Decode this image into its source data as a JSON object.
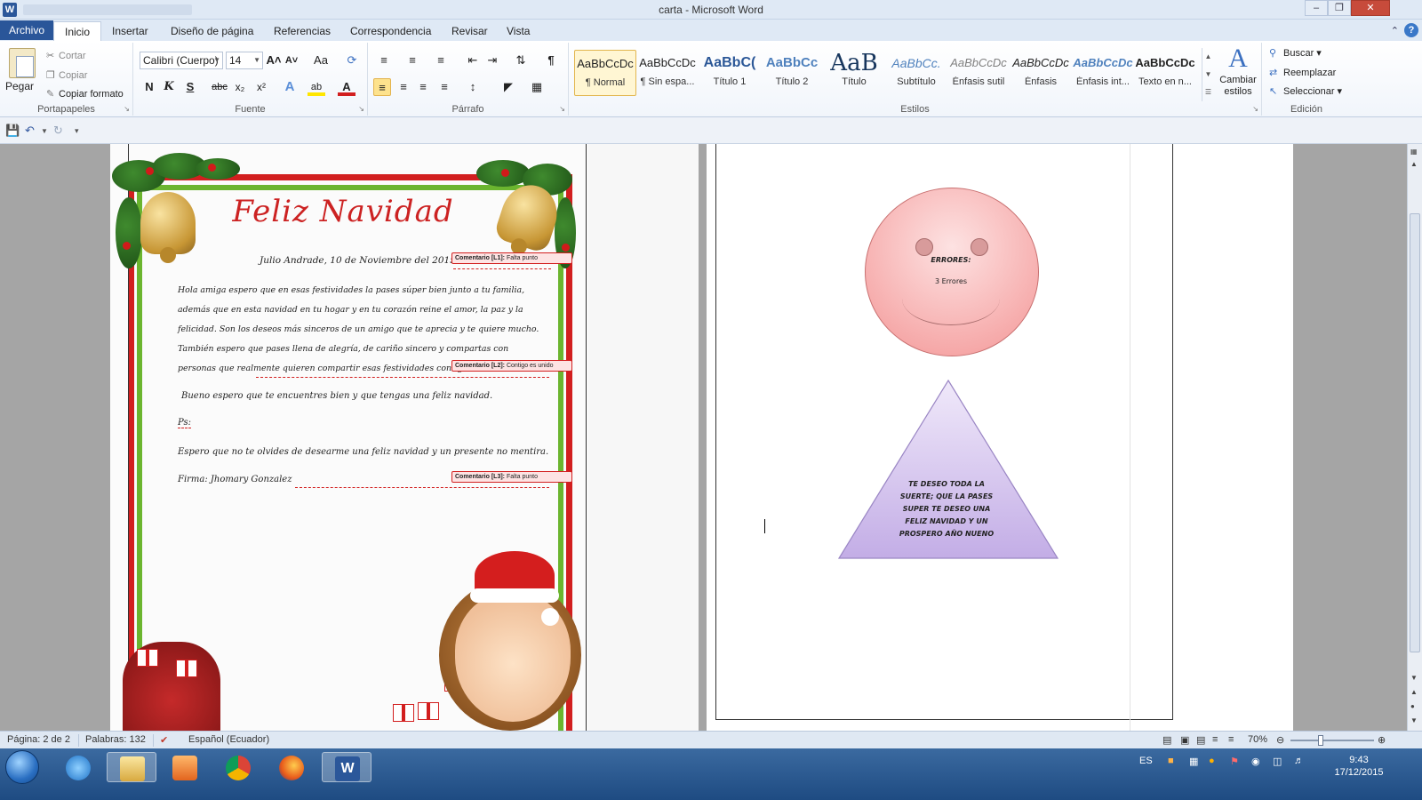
{
  "window": {
    "title": "carta - Microsoft Word",
    "app_icon": "W"
  },
  "tabs": [
    "Archivo",
    "Inicio",
    "Insertar",
    "Diseño de página",
    "Referencias",
    "Correspondencia",
    "Revisar",
    "Vista"
  ],
  "active_tab": "Inicio",
  "ribbon": {
    "clipboard": {
      "paste": "Pegar",
      "cut": "Cortar",
      "copy": "Copiar",
      "format_painter": "Copiar formato",
      "label": "Portapapeles"
    },
    "font": {
      "name": "Calibri (Cuerpo)",
      "size": "14",
      "label": "Fuente",
      "bold": "N",
      "italic": "K",
      "underline": "S",
      "strike": "abc",
      "sub": "x₂",
      "sup": "x²",
      "grow": "A˄",
      "shrink": "A˅",
      "case": "Aa"
    },
    "paragraph": {
      "label": "Párrafo",
      "pilcrow": "¶"
    },
    "styles": {
      "label": "Estilos",
      "items": [
        {
          "sample": "AaBbCcDc",
          "name": "¶ Normal"
        },
        {
          "sample": "AaBbCcDc",
          "name": "¶ Sin espa..."
        },
        {
          "sample": "AaBbC(",
          "name": "Título 1"
        },
        {
          "sample": "AaBbCc",
          "name": "Título 2"
        },
        {
          "sample": "AaB",
          "name": "Título"
        },
        {
          "sample": "AaBbCc.",
          "name": "Subtítulo"
        },
        {
          "sample": "AaBbCcDc",
          "name": "Énfasis sutil"
        },
        {
          "sample": "AaBbCcDc",
          "name": "Énfasis"
        },
        {
          "sample": "AaBbCcDc",
          "name": "Énfasis int..."
        },
        {
          "sample": "AaBbCcDc",
          "name": "Texto en n..."
        }
      ],
      "change_styles": "Cambiar estilos"
    },
    "editing": {
      "label": "Edición",
      "find": "Buscar",
      "replace": "Reemplazar",
      "select": "Seleccionar"
    }
  },
  "letter": {
    "title": "Feliz Navidad",
    "date_line": "Julio Andrade, 10 de Noviembre del 2015",
    "paragraph": "Hola amiga espero que en esas festividades la pases súper bien junto a tu familia, además que en esta navidad en tu hogar y en tu corazón reine el amor, la paz y la felicidad. Son los deseos más sinceros de un amigo que te aprecia y te quiere mucho. También espero que pases llena de alegría, de cariño sincero y compartas con personas que realmente quieren compartir esas festividades contigo.",
    "line2": "Bueno espero que te encuentres bien y que tengas una feliz navidad.",
    "ps": "Ps:",
    "line3": "Espero que no te olvides de desearme una feliz navidad y un presente no mentira.",
    "signature": "Firma: Jhomary Gonzalez"
  },
  "comments": [
    {
      "tag": "Comentario [L1]:",
      "text": "Falta punto"
    },
    {
      "tag": "Comentario [L2]:",
      "text": "Contigo es unido"
    },
    {
      "tag": "Comentario [L3]:",
      "text": "Falta punto"
    }
  ],
  "page2": {
    "errors_title": "ERRORES:",
    "errors_count": "3 Errores",
    "triangle_text": "TE DESEO TODA LA SUERTE; QUE LA PASES SUPER TE DESEO UNA FELIZ NAVIDAD Y UN PROSPERO AÑO NUENO"
  },
  "status": {
    "page": "Página: 2 de 2",
    "words": "Palabras: 132",
    "language": "Español (Ecuador)",
    "zoom": "70%"
  },
  "taskbar": {
    "time": "9:43",
    "date": "17/12/2015",
    "lang": "ES"
  },
  "colors": {
    "word_blue": "#2b579a",
    "comment_red": "#d21f1f",
    "title_red": "#cc2222",
    "smiley_pink": "#f6a9a9",
    "triangle_lilac": "#c9b6e6"
  }
}
